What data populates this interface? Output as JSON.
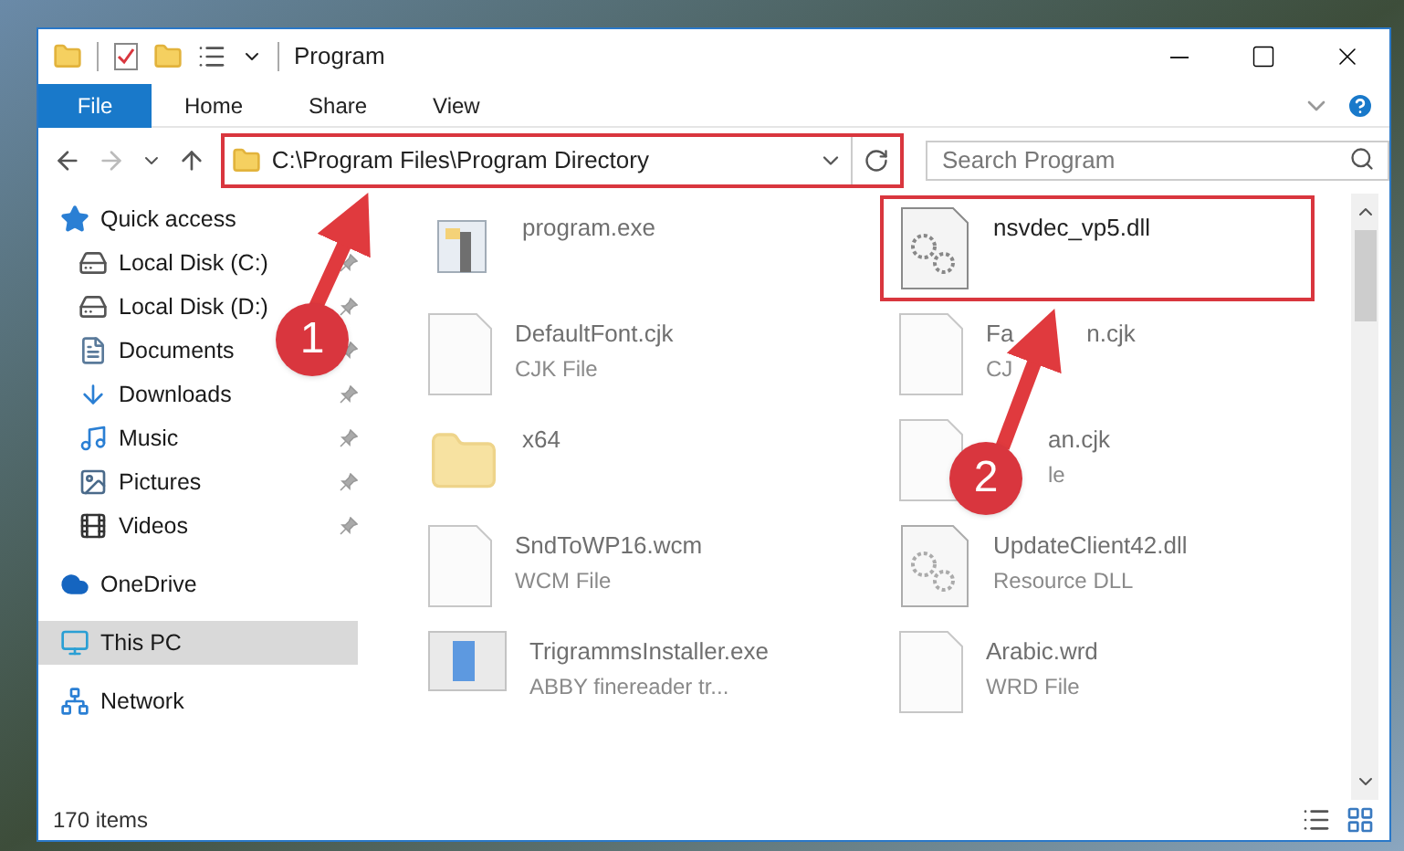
{
  "window": {
    "title": "Program"
  },
  "ribbon_tabs": [
    {
      "label": "File",
      "selected": true
    },
    {
      "label": "Home",
      "selected": false
    },
    {
      "label": "Share",
      "selected": false
    },
    {
      "label": "View",
      "selected": false
    }
  ],
  "address": {
    "path": "C:\\Program Files\\Program Directory",
    "highlighted": true
  },
  "search": {
    "placeholder": "Search Program"
  },
  "sidebar": {
    "items": [
      {
        "label": "Quick access",
        "kind": "star",
        "pinned": false,
        "selected": false,
        "children": [
          {
            "label": "Local Disk (C:)",
            "kind": "drive",
            "pinned": true,
            "selected": false
          },
          {
            "label": "Local Disk (D:)",
            "kind": "drive",
            "pinned": true,
            "selected": false
          },
          {
            "label": "Documents",
            "kind": "documents",
            "pinned": true,
            "selected": false
          },
          {
            "label": "Downloads",
            "kind": "downloads",
            "pinned": true,
            "selected": false
          },
          {
            "label": "Music",
            "kind": "music",
            "pinned": true,
            "selected": false
          },
          {
            "label": "Pictures",
            "kind": "pictures",
            "pinned": true,
            "selected": false
          },
          {
            "label": "Videos",
            "kind": "videos",
            "pinned": true,
            "selected": false
          }
        ]
      },
      {
        "label": "OneDrive",
        "kind": "cloud",
        "pinned": false,
        "selected": false
      },
      {
        "label": "This PC",
        "kind": "computer",
        "pinned": false,
        "selected": true
      },
      {
        "label": "Network",
        "kind": "network",
        "pinned": false,
        "selected": false
      }
    ]
  },
  "files": [
    {
      "name_parts": [
        "program.exe"
      ],
      "kind": "app",
      "dimmed": true,
      "highlighted": false,
      "covered_start": false
    },
    {
      "name_parts": [
        "nsvdec_vp5.dll"
      ],
      "kind": "dll",
      "dimmed": false,
      "highlighted": true,
      "covered_start": false
    },
    {
      "name_parts": [
        "DefaultFont.cjk"
      ],
      "type": "CJK File",
      "kind": "doc",
      "dimmed": true,
      "highlighted": false,
      "covered_start": false
    },
    {
      "name_parts": [
        "Fa",
        "n.cjk"
      ],
      "type": "CJ",
      "kind": "doc",
      "dimmed": true,
      "highlighted": false,
      "covered_start": false
    },
    {
      "name_parts": [
        "x64"
      ],
      "kind": "folder",
      "dimmed": true,
      "highlighted": false,
      "covered_start": false
    },
    {
      "name_parts": [
        "an.cjk"
      ],
      "type": "le",
      "kind": "doc",
      "dimmed": true,
      "highlighted": false,
      "covered_start": true
    },
    {
      "name_parts": [
        "SndToWP16.wcm"
      ],
      "type": "WCM File",
      "kind": "doc",
      "dimmed": true,
      "highlighted": false,
      "covered_start": false
    },
    {
      "name_parts": [
        "UpdateClient42.dll"
      ],
      "type": "Resource DLL",
      "kind": "dll",
      "dimmed": true,
      "highlighted": false,
      "covered_start": false
    },
    {
      "name_parts": [
        "TrigrammsInstaller.exe"
      ],
      "type": "ABBY finereader tr...",
      "kind": "installer",
      "dimmed": true,
      "highlighted": false,
      "covered_start": false
    },
    {
      "name_parts": [
        "Arabic.wrd"
      ],
      "type": "WRD File",
      "kind": "doc",
      "dimmed": true,
      "highlighted": false,
      "covered_start": false
    }
  ],
  "callouts": [
    {
      "label": "1"
    },
    {
      "label": "2"
    }
  ],
  "status_bar": {
    "count": "170 items"
  }
}
